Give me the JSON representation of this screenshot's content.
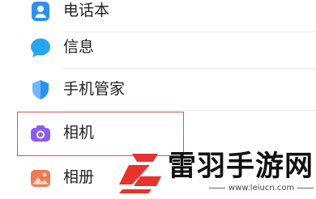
{
  "menu": {
    "items": [
      {
        "label": "电话本",
        "icon": "contacts-icon"
      },
      {
        "label": "信息",
        "icon": "message-icon"
      },
      {
        "label": "手机管家",
        "icon": "shield-icon"
      },
      {
        "label": "相机",
        "icon": "camera-icon",
        "highlighted": true
      },
      {
        "label": "相册",
        "icon": "gallery-icon"
      }
    ]
  },
  "watermark": {
    "title": "雷羽手游网",
    "url": "www.leiucn.com"
  },
  "colors": {
    "contacts": "#2f8ff0",
    "message": "#27a6f0",
    "shield": "#2f8ff0",
    "camera": "#8a5cf5",
    "gallery": "#f07a55",
    "highlight_border": "#d9534f",
    "watermark_logo": "#e8322e"
  }
}
